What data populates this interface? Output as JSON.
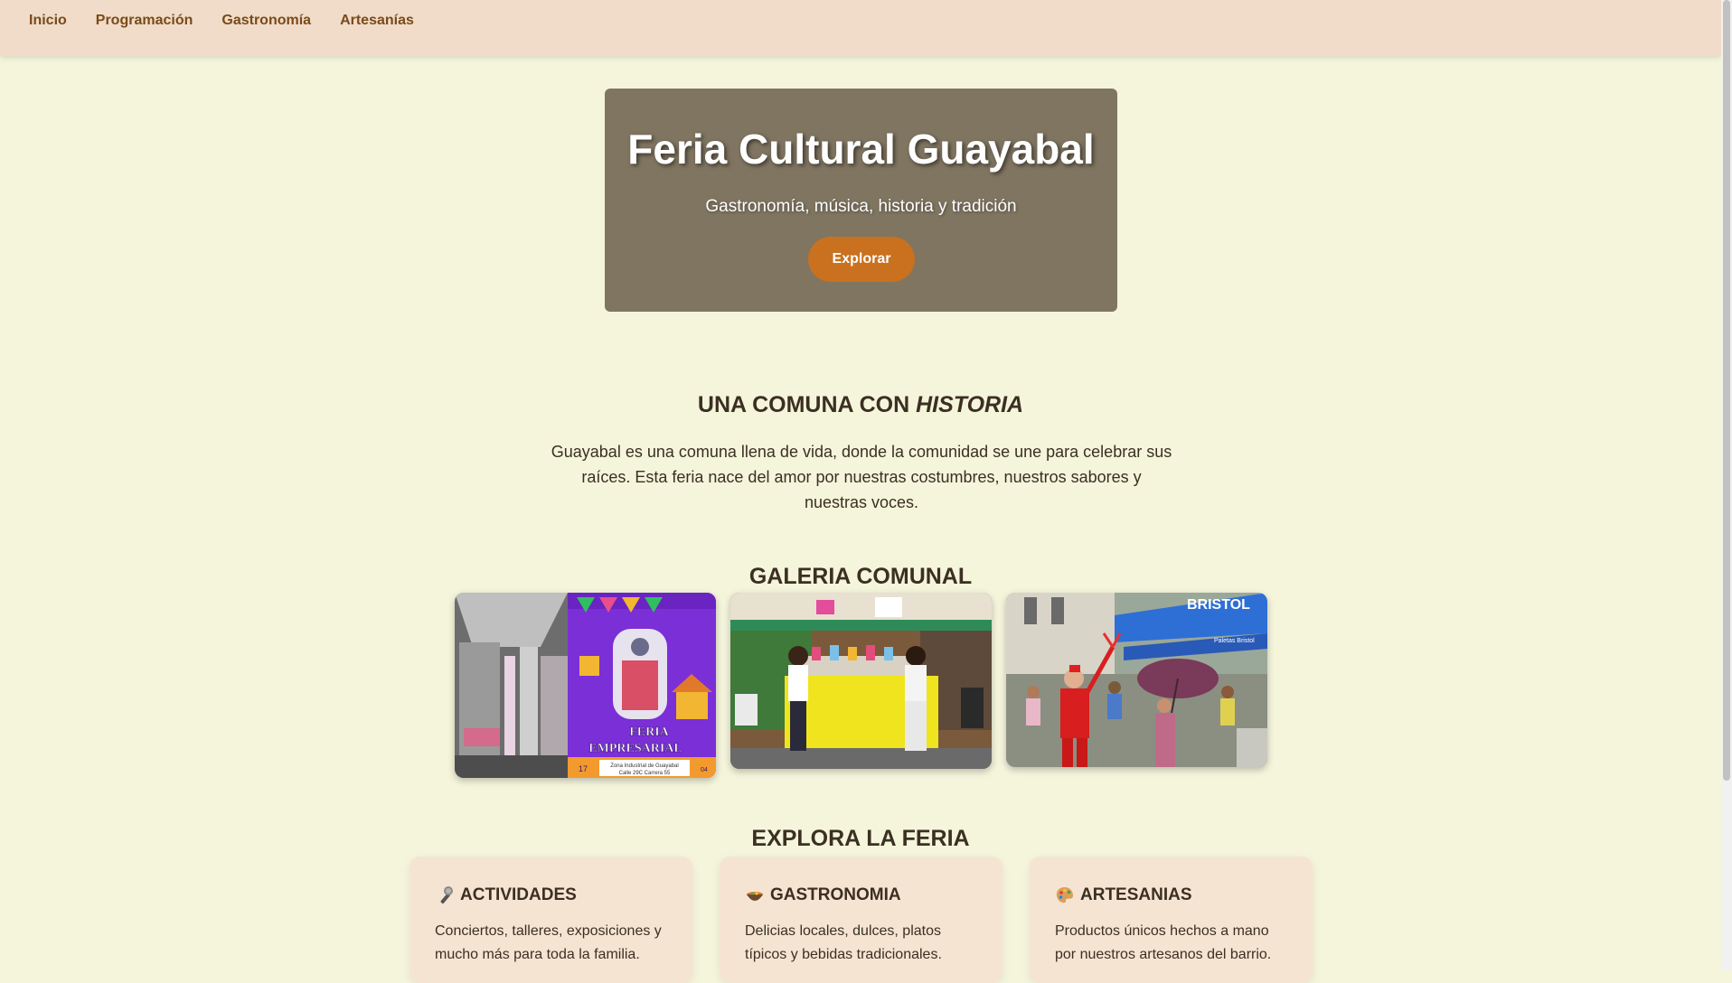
{
  "nav": {
    "items": [
      "Inicio",
      "Programación",
      "Gastronomía",
      "Artesanías"
    ]
  },
  "hero": {
    "title": "Feria Cultural Guayabal",
    "subtitle": "Gastronomía, música, historia y tradición",
    "button_label": "Explorar"
  },
  "history": {
    "title_plain": "UNA COMUNA CON ",
    "title_em": "HISTORIA",
    "text": "Guayabal es una comuna llena de vida, donde la comunidad se une para celebrar sus raíces. Esta feria nace del amor por nuestras costumbres, nuestros sabores y nuestras voces."
  },
  "gallery": {
    "title": "GALERIA COMUNAL",
    "poster_title": "FERIA EMPRESARIAL",
    "poster_address": "Zona Industrial de Guayabal",
    "poster_street": "Calle 29C Carrera 55",
    "poster_day_left": "17",
    "poster_day_right": "04",
    "sign_text": "BRISTOL",
    "sign_sub": "Paletas Bristol"
  },
  "explore": {
    "title": "EXPLORA LA FERIA",
    "cards": [
      {
        "icon": "microphone-icon",
        "title": "ACTIVIDADES",
        "text": "Conciertos, talleres, exposiciones y mucho más para toda la familia."
      },
      {
        "icon": "bowl-icon",
        "title": "GASTRONOMIA",
        "text": "Delicias locales, dulces, platos típicos y bebidas tradicionales."
      },
      {
        "icon": "palette-icon",
        "title": "ARTESANIAS",
        "text": "Productos únicos hechos a mano por nuestros artesanos del barrio."
      }
    ]
  },
  "colors": {
    "background": "#f5f5dc",
    "nav_bg": "#f0dcc8",
    "nav_link": "#7a4a1a",
    "hero_bg": "#807561",
    "accent": "#c9711e",
    "card_bg": "#f6e4d2",
    "text": "#3b2f22"
  }
}
